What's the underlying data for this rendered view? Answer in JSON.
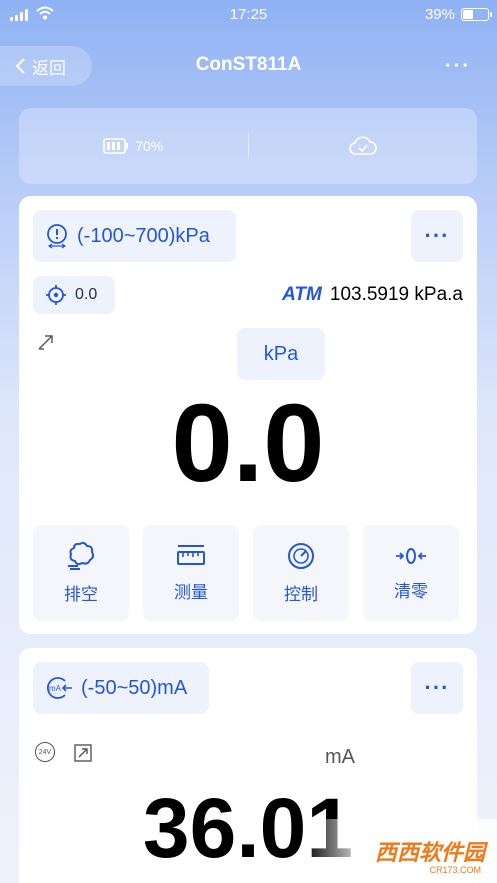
{
  "status_bar": {
    "time": "17:25",
    "battery_pct": "39%"
  },
  "nav": {
    "back_label": "返回",
    "title": "ConST811A",
    "more": "···"
  },
  "info": {
    "battery_level": "70%",
    "battery_icon": "battery-icon",
    "cloud_icon": "cloud-check-icon"
  },
  "channel1": {
    "range": "(-100~700)kPa",
    "zero_value": "0.0",
    "atm_label": "ATM",
    "atm_value": "103.5919 kPa.a",
    "unit": "kPa",
    "reading": "0.0",
    "more": "···",
    "buttons": [
      {
        "label": "排空",
        "icon": "vent-icon"
      },
      {
        "label": "测量",
        "icon": "ruler-icon"
      },
      {
        "label": "控制",
        "icon": "gauge-icon"
      },
      {
        "label": "清零",
        "icon": "zero-icon"
      }
    ]
  },
  "channel2": {
    "range": "(-50~50)mA",
    "unit": "mA",
    "reading": "36.01",
    "more": "···",
    "badge_24v": "24V"
  },
  "watermark": {
    "text": "西西软件园",
    "sub": "CR173.COM"
  },
  "colors": {
    "accent": "#2457d6",
    "chip_bg": "#eef2fc"
  }
}
